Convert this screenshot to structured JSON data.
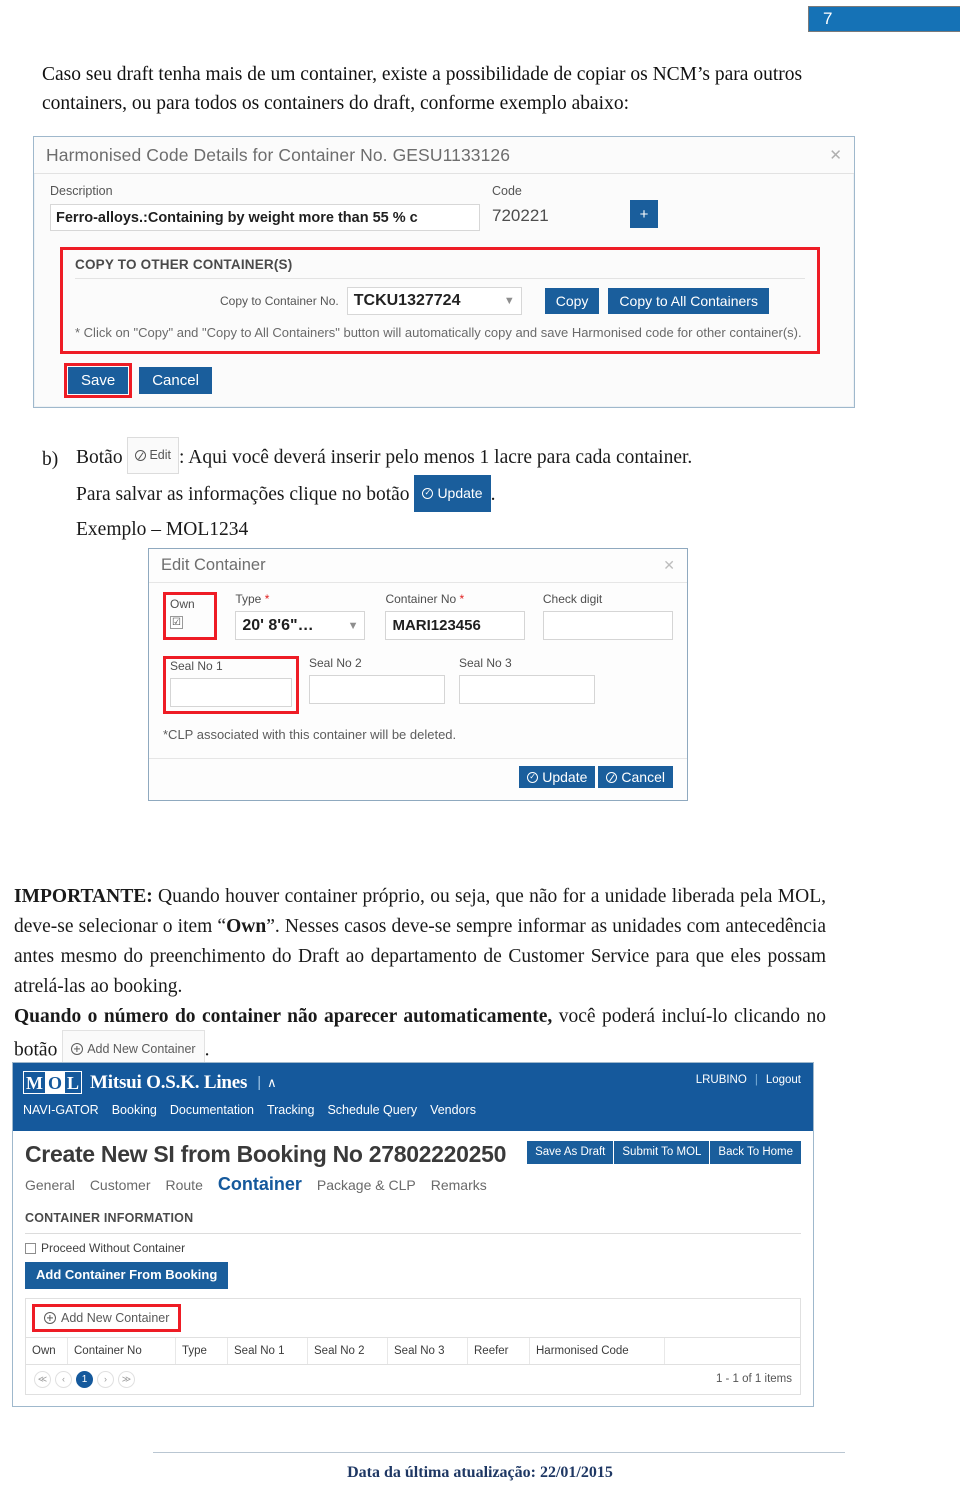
{
  "page": {
    "number": "7"
  },
  "intro": {
    "text": "Caso seu draft tenha mais de um container, existe a possibilidade de copiar os NCM’s para outros containers, ou para todos os containers do draft, conforme exemplo abaixo:"
  },
  "harmonised_dialog": {
    "title": "Harmonised Code Details for Container No. GESU1133126",
    "close_icon": "close-icon",
    "description_label": "Description",
    "description_value": "Ferro-alloys.:Containing by weight more than 55 % c",
    "code_label": "Code",
    "code_value": "720221",
    "add_button": "+",
    "copy_section_title": "COPY TO OTHER CONTAINER(S)",
    "copy_to_label": "Copy to Container No.",
    "copy_to_value": "TCKU1327724",
    "copy_button": "Copy",
    "copy_all_button": "Copy to All Containers",
    "note": "* Click on \"Copy\" and \"Copy to All Containers\" button will automatically copy and save Harmonised code for other container(s).",
    "save_button": "Save",
    "cancel_button": "Cancel"
  },
  "para_b": {
    "marker": "b)",
    "lead": "Botão",
    "edit_button": "Edit",
    "text1": ": Aqui você deverá inserir pelo menos 1 lacre para cada container.",
    "text2": "Para salvar as informações clique no botão",
    "update_button": "Update",
    "text3": ".",
    "example": "Exemplo – MOL1234"
  },
  "edit_container_dialog": {
    "title": "Edit Container",
    "close_icon": "close-icon",
    "own_label": "Own",
    "own_checked": "☑",
    "type_label": "Type *",
    "type_value": "20' 8'6\"…",
    "container_no_label": "Container No *",
    "container_no_value": "MARI123456",
    "check_digit_label": "Check digit",
    "check_digit_value": "",
    "seal1_label": "Seal No 1",
    "seal1_value": "",
    "seal2_label": "Seal No 2",
    "seal2_value": "",
    "seal3_label": "Seal No 3",
    "seal3_value": "",
    "clp_note": "*CLP associated with this container will be deleted.",
    "update_button": "Update",
    "cancel_button": "Cancel"
  },
  "importante": {
    "label": "IMPORTANTE:",
    "p1_a": " Quando houver container próprio, ou seja, que não for a unidade liberada pela MOL, deve-se selecionar o item “",
    "own_word": "Own",
    "p1_b": "”. Nesses casos deve-se sempre informar as unidades com antecedência antes mesmo do preenchimento do Draft ao departamento de Customer Service para que eles possam atrelá-las ao booking.",
    "p2_bold": "Quando o número do container não aparecer automaticamente,",
    "p2_rest": " você poderá incluí-lo clicando no botão",
    "add_new_container_button": "Add New Container",
    "p2_end": "."
  },
  "mol_app": {
    "logo": {
      "m": "M",
      "o": "O",
      "l": "L"
    },
    "brand_name": "Mitsui O.S.K. Lines",
    "brand_separator": "|",
    "brand_caret": "∧",
    "user": "LRUBINO",
    "user_divider": "|",
    "logout": "Logout",
    "nav": [
      "NAVI-GATOR",
      "Booking",
      "Documentation",
      "Tracking",
      "Schedule Query",
      "Vendors"
    ],
    "page_title": "Create New SI from Booking No 27802220250",
    "actions": [
      "Save As Draft",
      "Submit To MOL",
      "Back To Home"
    ],
    "tabs": [
      {
        "label": "General",
        "active": false
      },
      {
        "label": "Customer",
        "active": false
      },
      {
        "label": "Route",
        "active": false
      },
      {
        "label": "Container",
        "active": true
      },
      {
        "label": "Package & CLP",
        "active": false
      },
      {
        "label": "Remarks",
        "active": false
      }
    ],
    "section_title": "CONTAINER INFORMATION",
    "proceed_checkbox_label": "Proceed Without Container",
    "add_from_booking_button": "Add Container From Booking",
    "add_new_container_button": "Add New Container",
    "table_headers": [
      "Own",
      "Container No",
      "Type",
      "Seal No 1",
      "Seal No 2",
      "Seal No 3",
      "Reefer",
      "Harmonised Code"
    ],
    "pager": {
      "first": "≪",
      "prev": "‹",
      "current": "1",
      "next": "›",
      "last": "≫",
      "count_text": "1 - 1 of 1 items"
    }
  },
  "footer": {
    "text": "Data da última atualização: 22/01/2015"
  },
  "colors": {
    "brand_blue": "#15599c",
    "button_blue": "#1a5e9c",
    "highlight_red": "#ee1c25",
    "page_badge_blue": "#1572b6",
    "footer_navy": "#1f3864"
  }
}
